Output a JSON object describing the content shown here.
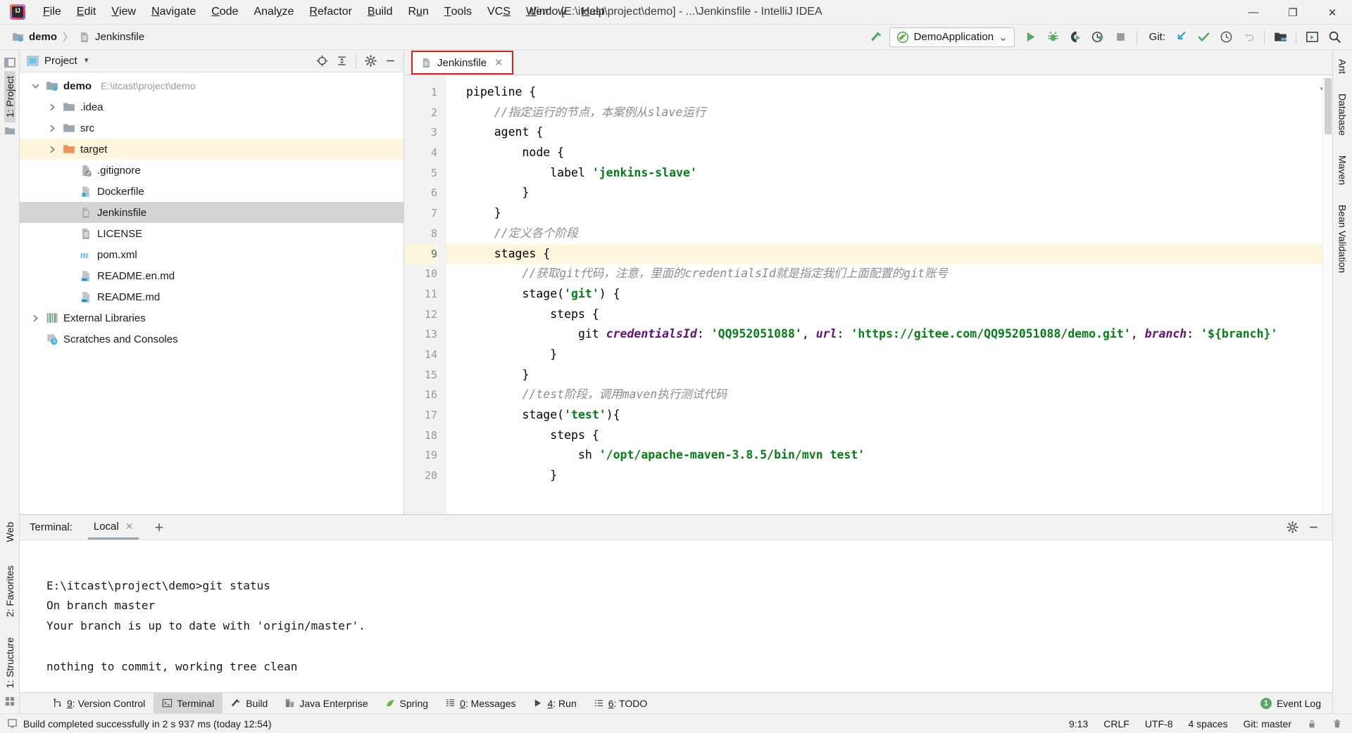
{
  "window": {
    "title": "demo [E:\\itcast\\project\\demo] - ...\\Jenkinsfile - IntelliJ IDEA",
    "minimize": "—",
    "maximize": "❐",
    "close": "✕"
  },
  "menubar": {
    "items": [
      {
        "pre": "",
        "hot": "F",
        "post": "ile"
      },
      {
        "pre": "",
        "hot": "E",
        "post": "dit"
      },
      {
        "pre": "",
        "hot": "V",
        "post": "iew"
      },
      {
        "pre": "",
        "hot": "N",
        "post": "avigate"
      },
      {
        "pre": "",
        "hot": "C",
        "post": "ode"
      },
      {
        "pre": "Anal",
        "hot": "y",
        "post": "ze"
      },
      {
        "pre": "",
        "hot": "R",
        "post": "efactor"
      },
      {
        "pre": "",
        "hot": "B",
        "post": "uild"
      },
      {
        "pre": "R",
        "hot": "u",
        "post": "n"
      },
      {
        "pre": "",
        "hot": "T",
        "post": "ools"
      },
      {
        "pre": "VC",
        "hot": "S",
        "post": ""
      },
      {
        "pre": "",
        "hot": "W",
        "post": "indow"
      },
      {
        "pre": "",
        "hot": "H",
        "post": "elp"
      }
    ]
  },
  "navbar": {
    "breadcrumb": [
      {
        "label": "demo",
        "icon": "module-folder-icon",
        "bold": true
      },
      {
        "label": "Jenkinsfile",
        "icon": "jenkins-file-icon",
        "bold": false
      }
    ],
    "separator": "〉",
    "run_config": {
      "name": "DemoApplication",
      "icon": "spring-boot-icon",
      "chevron": "⌄"
    },
    "git_label": "Git:",
    "actions": [
      {
        "name": "build-hammer-icon"
      },
      {
        "name": "run-button",
        "label": "Run"
      },
      {
        "name": "debug-button",
        "label": "Debug"
      },
      {
        "name": "run-coverage-button",
        "label": "Run with Coverage"
      },
      {
        "name": "profiler-button",
        "label": "Profile"
      },
      {
        "name": "stop-button",
        "label": "Stop"
      },
      {
        "name": "git-update-project-icon"
      },
      {
        "name": "git-commit-icon"
      },
      {
        "name": "git-history-icon"
      },
      {
        "name": "git-rollback-icon"
      },
      {
        "name": "select-opened-file-icon"
      },
      {
        "name": "run-anything-icon"
      },
      {
        "name": "search-everywhere-icon"
      }
    ]
  },
  "left_strip": {
    "items": [
      {
        "label": "1: Project",
        "hot": "1",
        "selected": true
      },
      {
        "label": "2: Favorites",
        "hot": "2",
        "selected": false
      },
      {
        "label": "1: Structure",
        "hot": "1",
        "selected": false
      }
    ],
    "web_label": "Web"
  },
  "right_strip": {
    "items": [
      "Ant",
      "Database",
      "Maven",
      "Bean Validation"
    ]
  },
  "project_panel": {
    "title": "Project",
    "chevron": "▼",
    "actions": [
      {
        "name": "scroll-from-source-icon"
      },
      {
        "name": "collapse-all-icon"
      },
      {
        "name": "settings-gear-icon"
      },
      {
        "name": "hide-panel-icon"
      }
    ],
    "tree": [
      {
        "depth": 0,
        "arrow": "expanded",
        "icon": "module-folder-icon",
        "label": "demo",
        "sub": "E:\\itcast\\project\\demo",
        "bold": true,
        "state": "none"
      },
      {
        "depth": 1,
        "arrow": "collapsed",
        "icon": "folder-icon",
        "label": ".idea",
        "sub": "",
        "bold": false,
        "state": "none"
      },
      {
        "depth": 1,
        "arrow": "collapsed",
        "icon": "folder-icon",
        "label": "src",
        "sub": "",
        "bold": false,
        "state": "none"
      },
      {
        "depth": 1,
        "arrow": "collapsed",
        "icon": "folder-orange-icon",
        "label": "target",
        "sub": "",
        "bold": false,
        "state": "highlight"
      },
      {
        "depth": 2,
        "arrow": "none",
        "icon": "gitignore-file-icon",
        "label": ".gitignore",
        "sub": "",
        "bold": false,
        "state": "none"
      },
      {
        "depth": 2,
        "arrow": "none",
        "icon": "dockerfile-icon",
        "label": "Dockerfile",
        "sub": "",
        "bold": false,
        "state": "none"
      },
      {
        "depth": 2,
        "arrow": "none",
        "icon": "jenkins-file-icon",
        "label": "Jenkinsfile",
        "sub": "",
        "bold": false,
        "state": "selected"
      },
      {
        "depth": 2,
        "arrow": "none",
        "icon": "text-file-icon",
        "label": "LICENSE",
        "sub": "",
        "bold": false,
        "state": "none"
      },
      {
        "depth": 2,
        "arrow": "none",
        "icon": "maven-pom-icon",
        "label": "pom.xml",
        "sub": "",
        "bold": false,
        "state": "none"
      },
      {
        "depth": 2,
        "arrow": "none",
        "icon": "markdown-file-icon",
        "label": "README.en.md",
        "sub": "",
        "bold": false,
        "state": "none"
      },
      {
        "depth": 2,
        "arrow": "none",
        "icon": "markdown-file-icon",
        "label": "README.md",
        "sub": "",
        "bold": false,
        "state": "none"
      },
      {
        "depth": 0,
        "arrow": "collapsed",
        "icon": "external-libraries-icon",
        "label": "External Libraries",
        "sub": "",
        "bold": false,
        "state": "none"
      },
      {
        "depth": 0,
        "arrow": "none",
        "icon": "scratches-icon",
        "label": "Scratches and Consoles",
        "sub": "",
        "bold": false,
        "state": "none"
      }
    ]
  },
  "editor": {
    "tab": {
      "label": "Jenkinsfile",
      "icon": "jenkins-file-icon",
      "close": "✕"
    },
    "current_line": 9,
    "inspection_ok": "✓",
    "lines": [
      {
        "n": 1,
        "tokens": [
          {
            "t": "pipeline {",
            "c": "kw"
          }
        ]
      },
      {
        "n": 2,
        "tokens": [
          {
            "t": "    //指定运行的节点，本案例从slave运行",
            "c": "cmt"
          }
        ]
      },
      {
        "n": 3,
        "tokens": [
          {
            "t": "    agent {",
            "c": "kw"
          }
        ]
      },
      {
        "n": 4,
        "tokens": [
          {
            "t": "        node {",
            "c": "kw"
          }
        ]
      },
      {
        "n": 5,
        "tokens": [
          {
            "t": "            label ",
            "c": "kw"
          },
          {
            "t": "'jenkins-slave'",
            "c": "str"
          }
        ]
      },
      {
        "n": 6,
        "tokens": [
          {
            "t": "        }",
            "c": "kw"
          }
        ]
      },
      {
        "n": 7,
        "tokens": [
          {
            "t": "    }",
            "c": "kw"
          }
        ]
      },
      {
        "n": 8,
        "tokens": [
          {
            "t": "    //定义各个阶段",
            "c": "cmt"
          }
        ]
      },
      {
        "n": 9,
        "tokens": [
          {
            "t": "    stages {",
            "c": "kw"
          }
        ]
      },
      {
        "n": 10,
        "tokens": [
          {
            "t": "        //获取git代码，注意，里面的credentialsId就是指定我们上面配置的git账号",
            "c": "cmt"
          }
        ]
      },
      {
        "n": 11,
        "tokens": [
          {
            "t": "        stage(",
            "c": "kw"
          },
          {
            "t": "'git'",
            "c": "str"
          },
          {
            "t": ") {",
            "c": "kw"
          }
        ]
      },
      {
        "n": 12,
        "tokens": [
          {
            "t": "            steps {",
            "c": "kw"
          }
        ]
      },
      {
        "n": 13,
        "tokens": [
          {
            "t": "                git ",
            "c": "kw"
          },
          {
            "t": "credentialsId",
            "c": "prm"
          },
          {
            "t": ": ",
            "c": "kw"
          },
          {
            "t": "'QQ952051088'",
            "c": "str"
          },
          {
            "t": ", ",
            "c": "kw"
          },
          {
            "t": "url",
            "c": "prm"
          },
          {
            "t": ": ",
            "c": "kw"
          },
          {
            "t": "'https://gitee.com/QQ952051088/demo.git'",
            "c": "str"
          },
          {
            "t": ", ",
            "c": "kw"
          },
          {
            "t": "branch",
            "c": "prm"
          },
          {
            "t": ": ",
            "c": "kw"
          },
          {
            "t": "'${branch}'",
            "c": "str"
          }
        ]
      },
      {
        "n": 14,
        "tokens": [
          {
            "t": "            }",
            "c": "kw"
          }
        ]
      },
      {
        "n": 15,
        "tokens": [
          {
            "t": "        }",
            "c": "kw"
          }
        ]
      },
      {
        "n": 16,
        "tokens": [
          {
            "t": "        //test阶段，调用maven执行测试代码",
            "c": "cmt"
          }
        ]
      },
      {
        "n": 17,
        "tokens": [
          {
            "t": "        stage(",
            "c": "kw"
          },
          {
            "t": "'test'",
            "c": "str"
          },
          {
            "t": "){",
            "c": "kw"
          }
        ]
      },
      {
        "n": 18,
        "tokens": [
          {
            "t": "            steps {",
            "c": "kw"
          }
        ]
      },
      {
        "n": 19,
        "tokens": [
          {
            "t": "                sh ",
            "c": "kw"
          },
          {
            "t": "'/opt/apache-maven-3.8.5/bin/mvn test'",
            "c": "str"
          }
        ]
      },
      {
        "n": 20,
        "tokens": [
          {
            "t": "            }",
            "c": "kw"
          }
        ]
      }
    ]
  },
  "terminal": {
    "label": "Terminal:",
    "tab": {
      "label": "Local",
      "close": "✕"
    },
    "add": "+",
    "actions": [
      {
        "name": "settings-gear-icon"
      },
      {
        "name": "hide-panel-icon"
      }
    ],
    "output": [
      "",
      "E:\\itcast\\project\\demo>git status",
      "On branch master",
      "Your branch is up to date with 'origin/master'.",
      "",
      "nothing to commit, working tree clean",
      ""
    ],
    "prompt": "E:\\itcast\\project\\demo>"
  },
  "toolwindow_bar": {
    "items": [
      {
        "pre": "",
        "hot": "9",
        "post": ": Version Control",
        "icon": "version-control-icon",
        "selected": false
      },
      {
        "pre": "",
        "hot": "",
        "post": "Terminal",
        "icon": "terminal-icon",
        "selected": true
      },
      {
        "pre": "",
        "hot": "",
        "post": "Build",
        "icon": "build-hammer-icon",
        "selected": false
      },
      {
        "pre": "",
        "hot": "",
        "post": "Java Enterprise",
        "icon": "java-enterprise-icon",
        "selected": false
      },
      {
        "pre": "",
        "hot": "",
        "post": "Spring",
        "icon": "spring-leaf-icon",
        "selected": false
      },
      {
        "pre": "",
        "hot": "0",
        "post": ": Messages",
        "icon": "messages-icon",
        "selected": false
      },
      {
        "pre": "",
        "hot": "4",
        "post": ": Run",
        "icon": "run-triangle-icon",
        "selected": false
      },
      {
        "pre": "",
        "hot": "6",
        "post": ": TODO",
        "icon": "todo-icon",
        "selected": false
      }
    ],
    "event_log": {
      "label": "Event Log",
      "count": "1"
    }
  },
  "statusbar": {
    "message": "Build completed successfully in 2 s 937 ms (today 12:54)",
    "caret": "9:13",
    "line_separator": "CRLF",
    "encoding": "UTF-8",
    "indent": "4 spaces",
    "branch": "Git: master",
    "icons": [
      {
        "name": "lock-icon"
      },
      {
        "name": "trash-icon"
      }
    ]
  }
}
